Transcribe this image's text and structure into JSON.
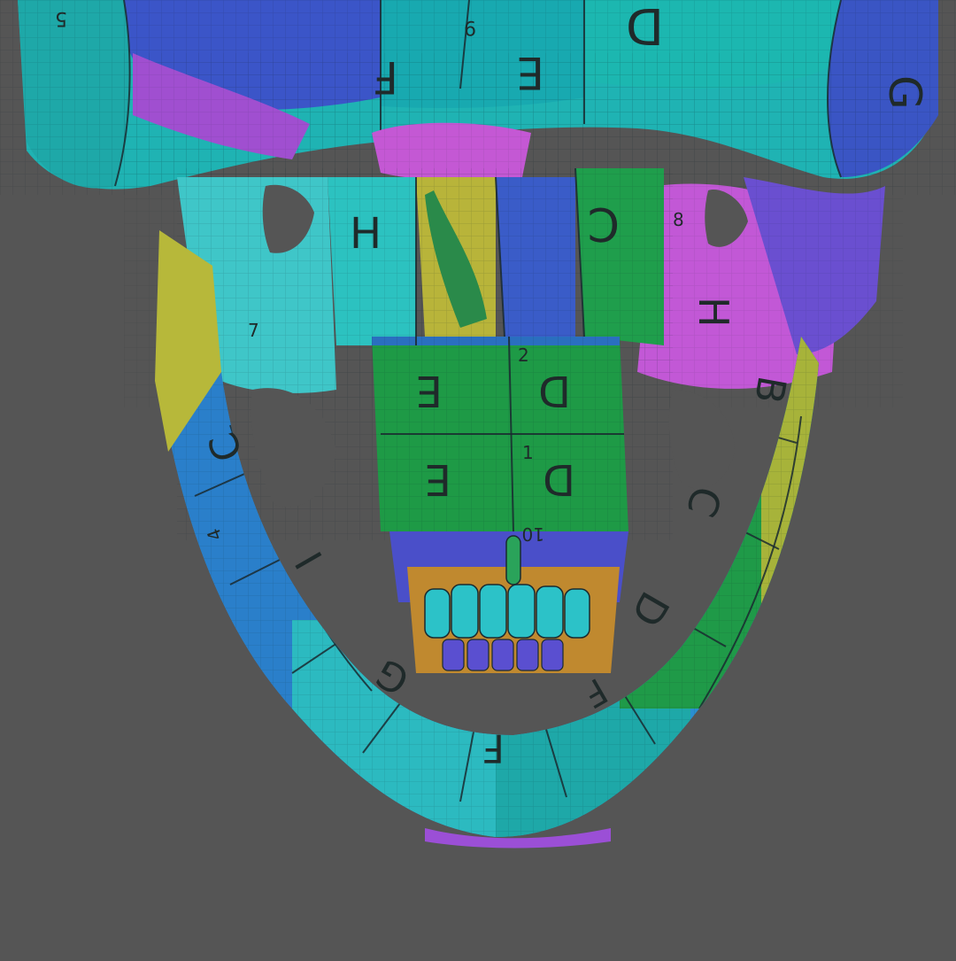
{
  "scene": {
    "background": "#555555",
    "palette": {
      "teal": "#1fb3b3",
      "cyan": "#2cc7c7",
      "blue": "#2a6fbf",
      "indigo": "#4a4fc9",
      "purple": "#9b4fd6",
      "magenta": "#c05bd8",
      "green": "#1e9a4a",
      "lime": "#3aa84a",
      "yellow": "#b7b83a",
      "orange": "#c9893a"
    },
    "uv_labels": [
      {
        "id": "l1",
        "text": "D"
      },
      {
        "id": "l2",
        "text": "E"
      },
      {
        "id": "l3",
        "text": "F"
      },
      {
        "id": "l4",
        "text": "H"
      },
      {
        "id": "l5",
        "text": "C"
      },
      {
        "id": "l6",
        "text": "D"
      },
      {
        "id": "l7",
        "text": "E"
      },
      {
        "id": "l8",
        "text": "D"
      },
      {
        "id": "l9",
        "text": "E"
      },
      {
        "id": "l10",
        "text": "H"
      },
      {
        "id": "l11",
        "text": "B"
      },
      {
        "id": "l12",
        "text": "C"
      },
      {
        "id": "l13",
        "text": "D"
      },
      {
        "id": "l14",
        "text": "F"
      },
      {
        "id": "l15",
        "text": "F"
      },
      {
        "id": "l16",
        "text": "G"
      },
      {
        "id": "l17",
        "text": "I"
      },
      {
        "id": "l18",
        "text": "C"
      },
      {
        "id": "l19",
        "text": "G"
      },
      {
        "id": "l20",
        "text": "9"
      },
      {
        "id": "l21",
        "text": "10"
      },
      {
        "id": "l22",
        "text": "2"
      },
      {
        "id": "l23",
        "text": "1"
      },
      {
        "id": "l24",
        "text": "5"
      },
      {
        "id": "l25",
        "text": "4"
      },
      {
        "id": "l26",
        "text": "7"
      },
      {
        "id": "l27",
        "text": "8"
      }
    ]
  }
}
